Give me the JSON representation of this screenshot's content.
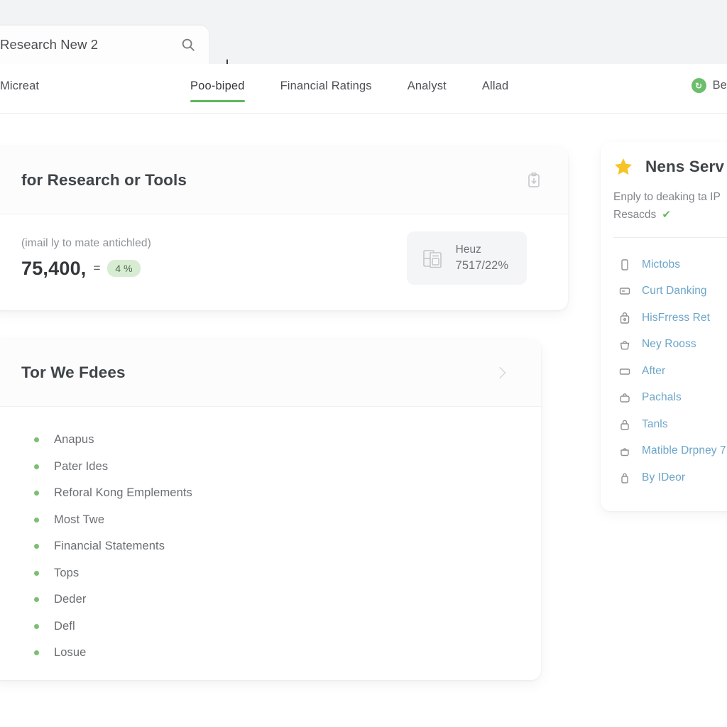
{
  "browser": {
    "tab_title": "Research New 2",
    "search_icon": "search-icon",
    "new_tab_label": "+"
  },
  "nav": {
    "brand": "Micreat",
    "items": [
      {
        "label": "Poo-biped",
        "active": true
      },
      {
        "label": "Financial Ratings",
        "active": false
      },
      {
        "label": "Analyst",
        "active": false
      },
      {
        "label": "Allad",
        "active": false
      }
    ],
    "right": {
      "badge_glyph": "↻",
      "label": "Beti",
      "accent": "#6cbe6c"
    },
    "active_underline_color": "#5cb85c"
  },
  "metric_card": {
    "title": "for Research or Tools",
    "head_icon": "clipboard-download-icon",
    "caption": "(imail ly to mate antichled)",
    "value": "75,400,",
    "equals": "=",
    "chip": "4 %",
    "chip_bg": "#d8ecd3",
    "tile": {
      "icon": "documents-icon",
      "label": "Heuz",
      "value": "7517/22%"
    }
  },
  "list_card": {
    "title": "Tor We Fdees",
    "chevron_icon": "chevron-right-icon",
    "bullet_color": "#7cbf72",
    "items": [
      "Anapus",
      "Pater Ides",
      "Reforal Kong Emplements",
      "Most Twe",
      "Financial Statements",
      "Tops",
      "Deder",
      "Defl",
      "Losue"
    ]
  },
  "side_panel": {
    "star_icon": "star-icon",
    "title": "Nens Serv",
    "desc_line1": "Enply to deaking ta IP",
    "desc_line2": "Resacds",
    "check_glyph": "✔",
    "link_color": "#6ca5c9",
    "items": [
      {
        "label": "Mictobs",
        "icon": "phone-icon"
      },
      {
        "label": "Curt Danking",
        "icon": "wallet-icon"
      },
      {
        "label": "HisFrress Ret",
        "icon": "lock-bag-icon"
      },
      {
        "label": "Ney Rooss",
        "icon": "basket-icon"
      },
      {
        "label": "After",
        "icon": "card-icon"
      },
      {
        "label": "Pachals",
        "icon": "bag-icon"
      },
      {
        "label": "Tanls",
        "icon": "lock-icon"
      },
      {
        "label": "Matible Drpney 7",
        "icon": "pot-icon"
      },
      {
        "label": "By IDeor",
        "icon": "padlock-icon"
      }
    ]
  }
}
